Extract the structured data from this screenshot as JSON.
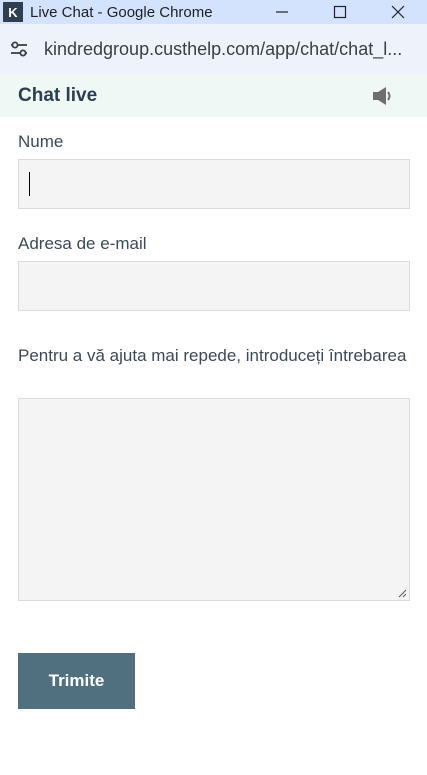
{
  "window": {
    "title": "Live Chat - Google Chrome",
    "app_icon_letter": "K",
    "controls": [
      "minimize-icon",
      "maximize-icon",
      "close-icon"
    ]
  },
  "browser": {
    "url": "kindredgroup.custhelp.com/app/chat/chat_l...",
    "site_info_icon": "tune-icon"
  },
  "chat": {
    "title": "Chat live",
    "sound_icon": "speaker-icon"
  },
  "form": {
    "name_label": "Nume",
    "name_value": "",
    "email_label": "Adresa de e-mail",
    "email_value": "",
    "question_label": "Pentru a vă ajuta mai repede, introduceți întrebarea",
    "question_value": "",
    "submit_label": "Trimite"
  },
  "colors": {
    "titlebar_bg": "#d3e3fd",
    "addressbar_bg": "#eef2fa",
    "chat_header_bg": "#f0f8f6",
    "field_bg": "#f4f4f4",
    "submit_bg": "#50707f"
  }
}
